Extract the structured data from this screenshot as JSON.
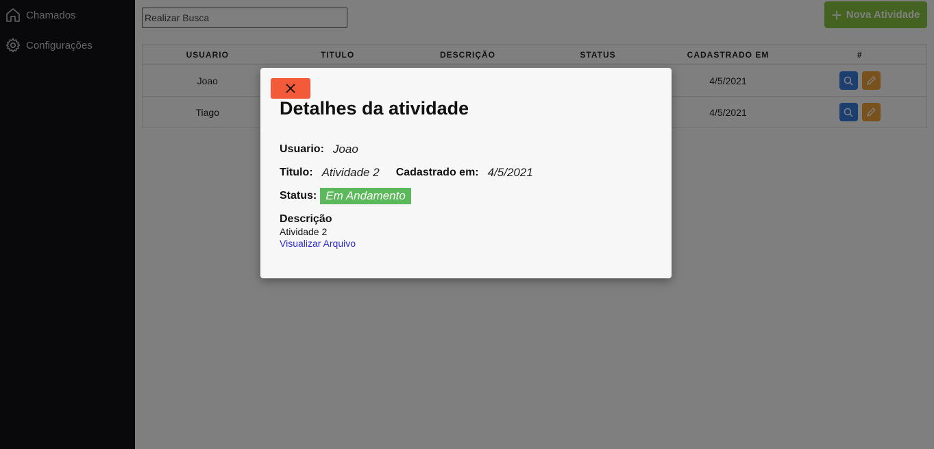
{
  "sidebar": {
    "items": [
      {
        "label": "Chamados",
        "icon": "home-icon"
      },
      {
        "label": "Configurações",
        "icon": "gear-icon"
      }
    ]
  },
  "toolbar": {
    "search_placeholder": "Realizar Busca",
    "search_value": "",
    "new_button_label": "Nova Atividade"
  },
  "table": {
    "headers": [
      "USUARIO",
      "TITULO",
      "DESCRIÇÃO",
      "STATUS",
      "CADASTRADO EM",
      "#"
    ],
    "rows": [
      {
        "usuario": "Joao",
        "titulo": "",
        "descricao": "",
        "status": "",
        "cadastrado": "4/5/2021"
      },
      {
        "usuario": "Tiago",
        "titulo": "",
        "descricao": "",
        "status": "",
        "cadastrado": "4/5/2021"
      }
    ]
  },
  "modal": {
    "title": "Detalhes da atividade",
    "usuario_label": "Usuario:",
    "usuario_value": "Joao",
    "titulo_label": "Titulo:",
    "titulo_value": "Atividade 2",
    "cadastrado_label": "Cadastrado em:",
    "cadastrado_value": "4/5/2021",
    "status_label": "Status:",
    "status_value": "Em Andamento",
    "descricao_label": "Descrição",
    "descricao_value": "Atividade 2",
    "file_link": "Visualizar Arquivo"
  },
  "colors": {
    "sidebar_bg": "#121316",
    "new_button": "#88c440",
    "view_button": "#3a7fe0",
    "edit_button": "#f0a23a",
    "close_button": "#f25a3a",
    "status_badge": "#5bb85b",
    "link": "#2b2bd0"
  }
}
